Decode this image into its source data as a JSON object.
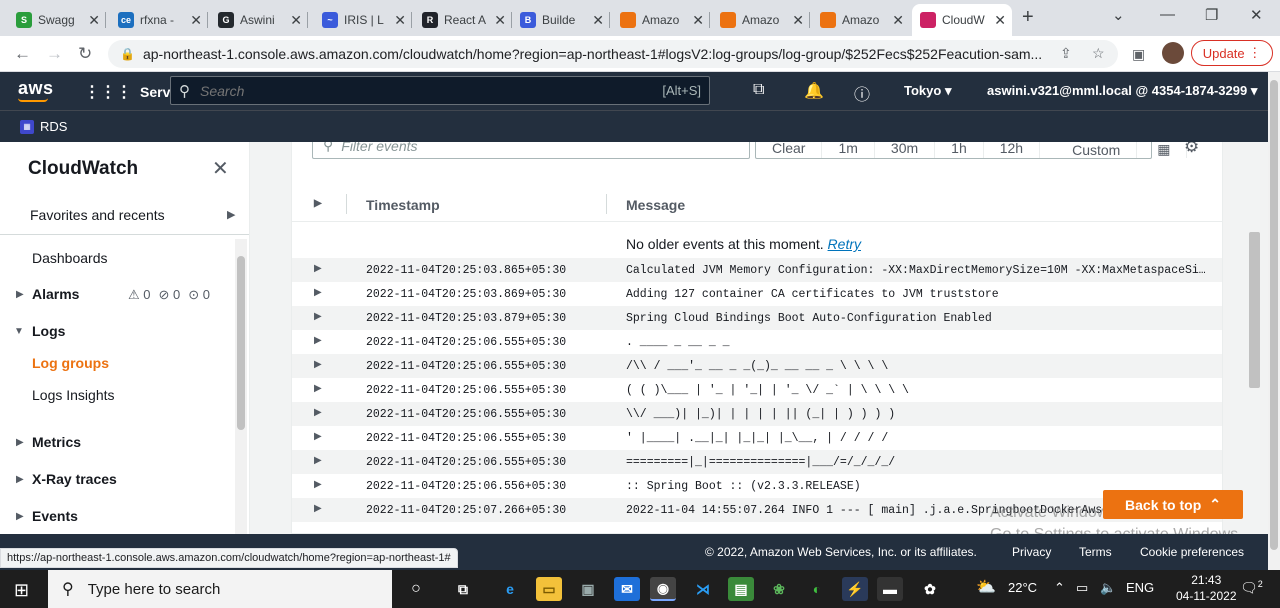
{
  "browser": {
    "tabs": [
      {
        "label": "Swagg",
        "color": "#2a9d3c",
        "icon": "S"
      },
      {
        "label": "rfxna -",
        "color": "#1c6fbf",
        "icon": "ce"
      },
      {
        "label": "Aswini",
        "color": "#24292e",
        "icon": "G"
      },
      {
        "label": "IRIS | L",
        "color": "#3b5bdb",
        "icon": "~"
      },
      {
        "label": "React A",
        "color": "#20232a",
        "icon": "R"
      },
      {
        "label": "Builde",
        "color": "#3b5bdb",
        "icon": "B"
      },
      {
        "label": "Amazo",
        "color": "#ec7211",
        "icon": ""
      },
      {
        "label": "Amazo",
        "color": "#ec7211",
        "icon": ""
      },
      {
        "label": "Amazo",
        "color": "#ec7211",
        "icon": ""
      },
      {
        "label": "CloudW",
        "color": "#cc2264",
        "icon": ""
      }
    ],
    "url": "ap-northeast-1.console.aws.amazon.com/cloudwatch/home?region=ap-northeast-1#logsV2:log-groups/log-group/$252Fecs$252Feacution-sam...",
    "update_label": "Update",
    "status_url": "https://ap-northeast-1.console.aws.amazon.com/cloudwatch/home?region=ap-northeast-1#"
  },
  "aws_nav": {
    "logo": "aws",
    "services": "Services",
    "search_placeholder": "Search",
    "search_shortcut": "[Alt+S]",
    "region": "Tokyo",
    "account": "aswini.v321@mml.local @ 4354-1874-3299",
    "favorite": "RDS"
  },
  "sidebar": {
    "title": "CloudWatch",
    "favorites": "Favorites and recents",
    "dashboards": "Dashboards",
    "alarms": "Alarms",
    "alarm_counts": [
      "0",
      "0",
      "0"
    ],
    "logs": "Logs",
    "log_groups": "Log groups",
    "logs_insights": "Logs Insights",
    "metrics": "Metrics",
    "xray": "X-Ray traces",
    "events": "Events"
  },
  "log_view": {
    "filter_placeholder": "Filter events",
    "ranges": [
      "Clear",
      "1m",
      "30m",
      "1h",
      "12h",
      "Custom"
    ],
    "col_timestamp": "Timestamp",
    "col_message": "Message",
    "no_older": "No older events at this moment.",
    "retry": "Retry",
    "rows": [
      {
        "ts": "2022-11-04T20:25:03.865+05:30",
        "msg": "Calculated JVM Memory Configuration: -XX:MaxDirectMemorySize=10M -XX:MaxMetaspaceSize=..."
      },
      {
        "ts": "2022-11-04T20:25:03.869+05:30",
        "msg": "Adding 127 container CA certificates to JVM truststore"
      },
      {
        "ts": "2022-11-04T20:25:03.879+05:30",
        "msg": "Spring Cloud Bindings Boot Auto-Configuration Enabled"
      },
      {
        "ts": "2022-11-04T20:25:06.555+05:30",
        "msg": ". ____ _ __ _ _"
      },
      {
        "ts": "2022-11-04T20:25:06.555+05:30",
        "msg": "/\\\\ / ___'_ __ _ _(_)_ __ __ _ \\ \\ \\ \\"
      },
      {
        "ts": "2022-11-04T20:25:06.555+05:30",
        "msg": "( ( )\\___ | '_ | '_| | '_ \\/ _` | \\ \\ \\ \\"
      },
      {
        "ts": "2022-11-04T20:25:06.555+05:30",
        "msg": "\\\\/ ___)| |_)| | | | | || (_| | ) ) ) )"
      },
      {
        "ts": "2022-11-04T20:25:06.555+05:30",
        "msg": "' |____| .__|_| |_|_| |_\\__, | / / / /"
      },
      {
        "ts": "2022-11-04T20:25:06.555+05:30",
        "msg": "=========|_|==============|___/=/_/_/_/"
      },
      {
        "ts": "2022-11-04T20:25:06.556+05:30",
        "msg": ":: Spring Boot :: (v2.3.3.RELEASE)"
      },
      {
        "ts": "2022-11-04T20:25:07.266+05:30",
        "msg": "2022-11-04 14:55:07.264 INFO 1 --- [ main] .j.a.e.SpringbootDockerAwsEcs"
      }
    ],
    "back_to_top": "Back to top",
    "watermark_line1": "Activate Windows",
    "watermark_line2": "Go to Settings to activate Windows."
  },
  "footer": {
    "copyright": "© 2022, Amazon Web Services, Inc. or its affiliates.",
    "privacy": "Privacy",
    "terms": "Terms",
    "cookies": "Cookie preferences"
  },
  "taskbar": {
    "search_placeholder": "Type here to search",
    "temperature": "22°C",
    "language": "ENG",
    "time": "21:43",
    "date": "04-11-2022",
    "notifications": "2"
  }
}
